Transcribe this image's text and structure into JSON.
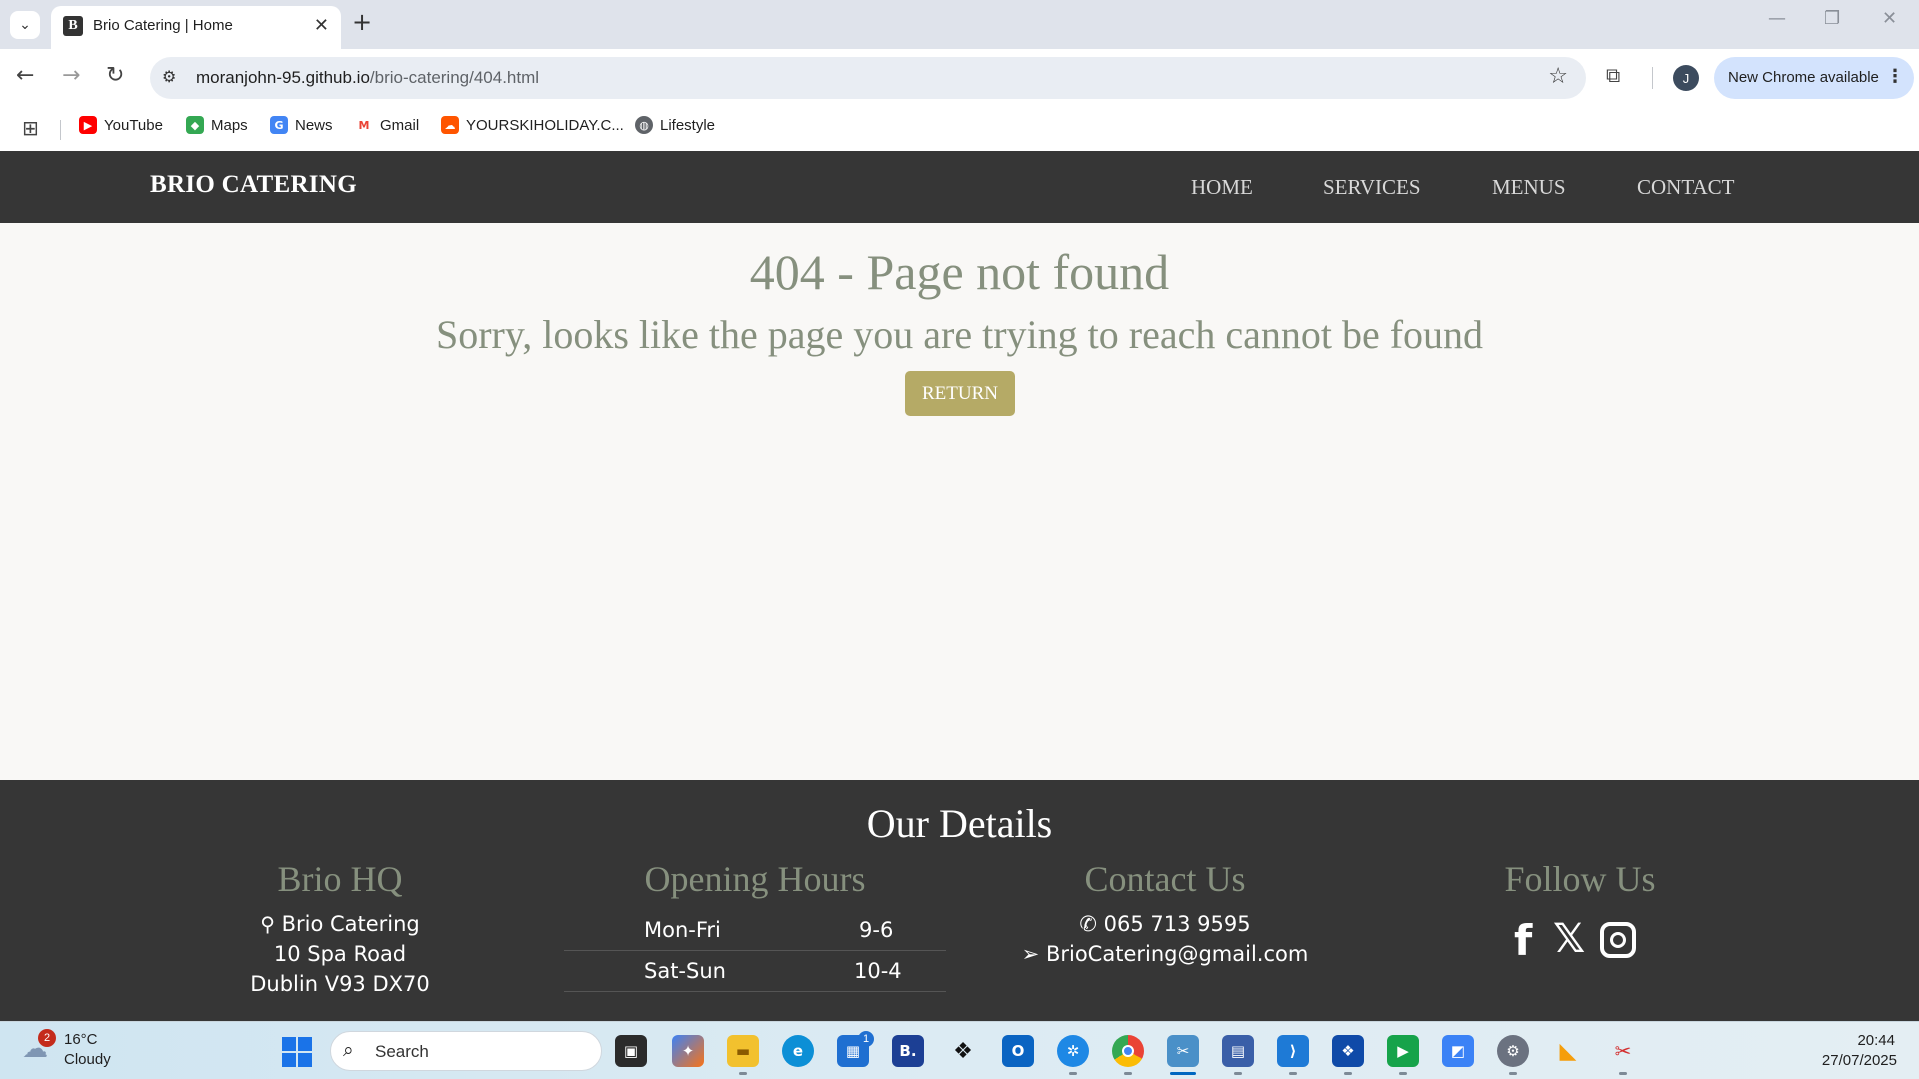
{
  "browser": {
    "tab_title": "Brio Catering | Home",
    "tab_favicon": "B",
    "url_host": "moranjohn-95.github.io",
    "url_path": "/brio-catering/404.html",
    "update_label": "New Chrome available",
    "profile_initial": "J",
    "bookmarks": [
      {
        "label": "YouTube",
        "icon": "youtube-icon",
        "color": "#ff0000"
      },
      {
        "label": "Maps",
        "icon": "maps-icon",
        "color": "#34a853"
      },
      {
        "label": "News",
        "icon": "news-icon",
        "color": "#4285f4"
      },
      {
        "label": "Gmail",
        "icon": "gmail-icon",
        "color": "#ea4335"
      },
      {
        "label": "YOURSKIHOLIDAY.C...",
        "icon": "soundcloud-icon",
        "color": "#ff5500"
      },
      {
        "label": "Lifestyle",
        "icon": "globe-icon",
        "color": "#5f6368"
      }
    ]
  },
  "site": {
    "brand": "BRIO CATERING",
    "nav": [
      "HOME",
      "SERVICES",
      "MENUS",
      "CONTACT"
    ],
    "colors": {
      "header_bg": "#363636",
      "accent_text": "#86907e",
      "button_bg": "#b5aa66",
      "page_bg": "#f9f8f6"
    }
  },
  "error": {
    "title": "404 - Page not found",
    "message": "Sorry, looks like the page you are trying to reach cannot be found",
    "button": "RETURN"
  },
  "footer": {
    "title": "Our Details",
    "hq": {
      "title": "Brio HQ",
      "lines": [
        "Brio Catering",
        "10 Spa Road",
        "Dublin V93 DX70"
      ]
    },
    "hours": {
      "title": "Opening Hours",
      "rows": [
        {
          "days": "Mon-Fri",
          "time": "9-6"
        },
        {
          "days": "Sat-Sun",
          "time": "10-4"
        }
      ]
    },
    "contact": {
      "title": "Contact Us",
      "phone": "065 713 9595",
      "email": "BrioCatering@gmail.com"
    },
    "follow": {
      "title": "Follow Us",
      "icons": [
        "facebook-icon",
        "x-icon",
        "instagram-icon"
      ]
    }
  },
  "taskbar": {
    "weather_temp": "16°C",
    "weather_cond": "Cloudy",
    "weather_badge": "2",
    "search_label": "Search",
    "time": "20:44",
    "date": "27/07/2025",
    "store_badge": "1"
  }
}
